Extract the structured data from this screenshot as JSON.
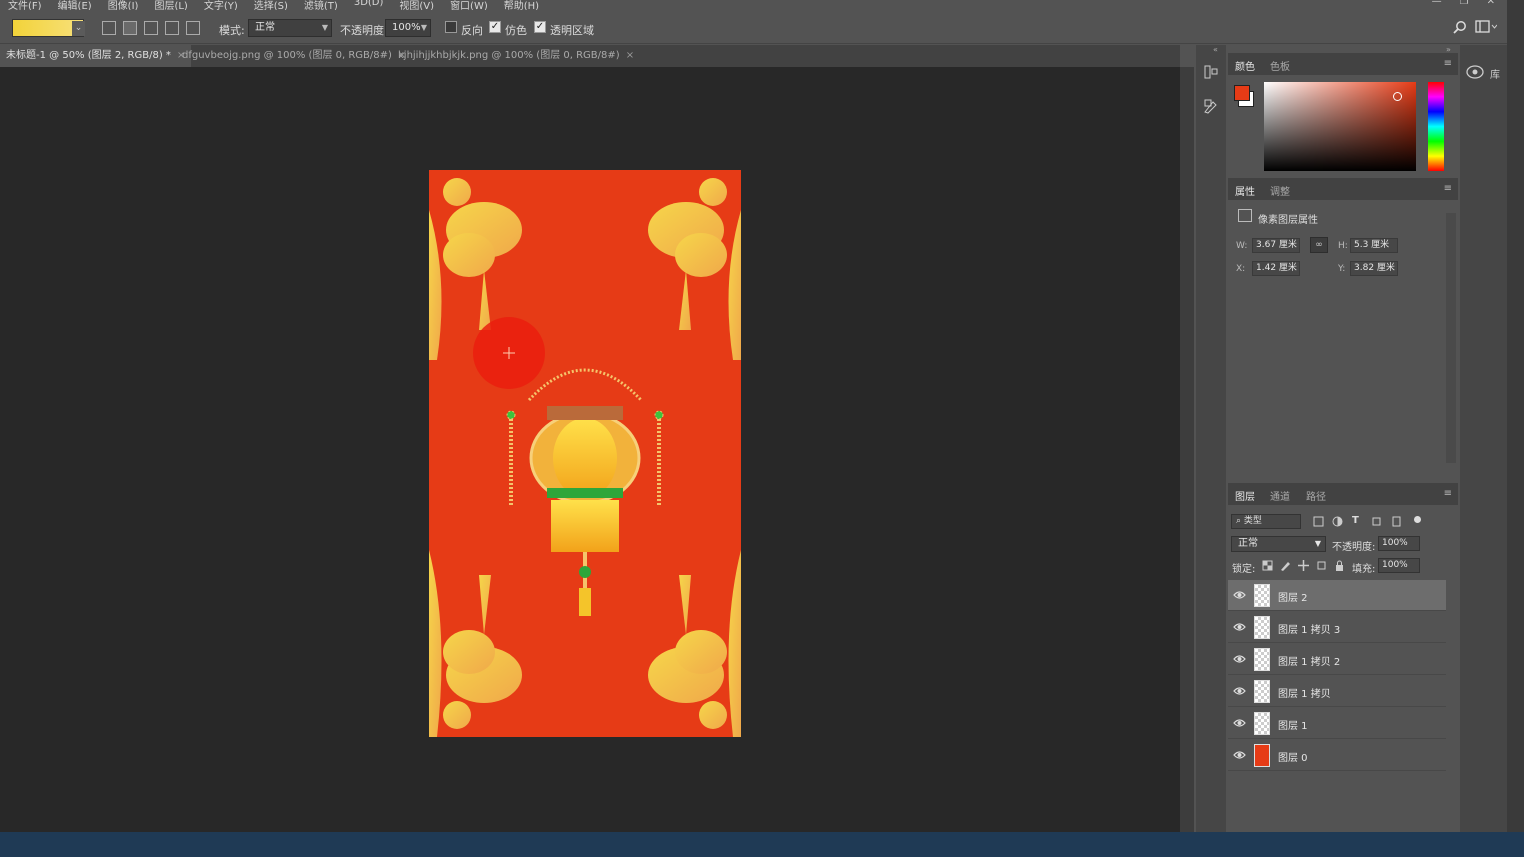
{
  "menu": {
    "items": [
      "文件(F)",
      "编辑(E)",
      "图像(I)",
      "图层(L)",
      "文字(Y)",
      "选择(S)",
      "滤镜(T)",
      "3D(D)",
      "视图(V)",
      "窗口(W)",
      "帮助(H)"
    ]
  },
  "options": {
    "mode_label": "模式:",
    "mode_value": "正常",
    "opacity_label": "不透明度:",
    "opacity_value": "100%",
    "reverse_label": "反向",
    "dither_label": "仿色",
    "transparency_label": "透明区域",
    "reverse_checked": false,
    "dither_checked": true,
    "transparency_checked": true,
    "gradient_colors": [
      "#f2d33a",
      "#f7e07a"
    ]
  },
  "tabs": [
    {
      "label": "未标题-1 @ 50% (图层 2, RGB/8) *"
    },
    {
      "label": "dfguvbeojg.png @ 100% (图层 0, RGB/8#)"
    },
    {
      "label": "kjhjihjjkhbjkjk.png @ 100% (图层 0, RGB/8#)"
    }
  ],
  "color_panel": {
    "tabs": [
      "颜色",
      "色板"
    ],
    "foreground": "#e63b16",
    "background": "#ffffff"
  },
  "properties_panel": {
    "tabs": [
      "属性",
      "调整"
    ],
    "title": "像素图层属性",
    "w_label": "W:",
    "w_value": "3.67 厘米",
    "h_label": "H:",
    "h_value": "5.3 厘米",
    "x_label": "X:",
    "x_value": "1.42 厘米",
    "y_label": "Y:",
    "y_value": "3.82 厘米"
  },
  "layers_panel": {
    "tabs": [
      "图层",
      "通道",
      "路径"
    ],
    "filter_label": "类型",
    "blend_mode": "正常",
    "opacity_label": "不透明度:",
    "opacity_value": "100%",
    "lock_label": "锁定:",
    "fill_label": "填充:",
    "fill_value": "100%",
    "layers": [
      {
        "name": "图层 2",
        "selected": true,
        "thumb": "transparent"
      },
      {
        "name": "图层 1 拷贝 3",
        "selected": false,
        "thumb": "transparent"
      },
      {
        "name": "图层 1 拷贝 2",
        "selected": false,
        "thumb": "transparent"
      },
      {
        "name": "图层 1 拷贝",
        "selected": false,
        "thumb": "transparent"
      },
      {
        "name": "图层 1",
        "selected": false,
        "thumb": "transparent"
      },
      {
        "name": "图层 0",
        "selected": false,
        "thumb": "red"
      }
    ]
  },
  "far_right": {
    "library_label": "库"
  },
  "canvas": {
    "background_color": "#e63b16",
    "accent_gold": "#f1c04a"
  }
}
